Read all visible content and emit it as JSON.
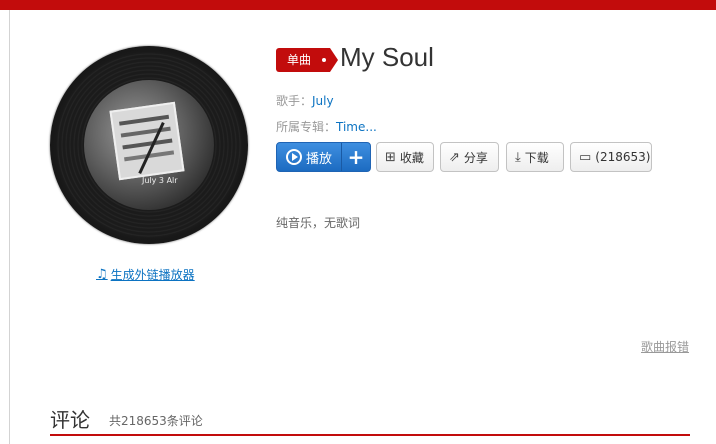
{
  "song": {
    "type_badge": "单曲",
    "title": "My Soul",
    "singer_label": "歌手：",
    "singer": "July",
    "album_label": "所属专辑：",
    "album": "Time...",
    "cover_text": "July 3 Alr",
    "description": "纯音乐，无歌词"
  },
  "external_player_link": "生成外链播放器",
  "actions": {
    "play": "播放",
    "add": "+",
    "favorite": "收藏",
    "share": "分享",
    "download": "下载",
    "comment": "(218653)"
  },
  "report_label": "歌曲报错",
  "comments": {
    "title": "评论",
    "count_text": "共218653条评论"
  },
  "colors": {
    "brand_red": "#c20c0c",
    "link_blue": "#0c73c2",
    "play_blue": "#2b7dd8"
  }
}
